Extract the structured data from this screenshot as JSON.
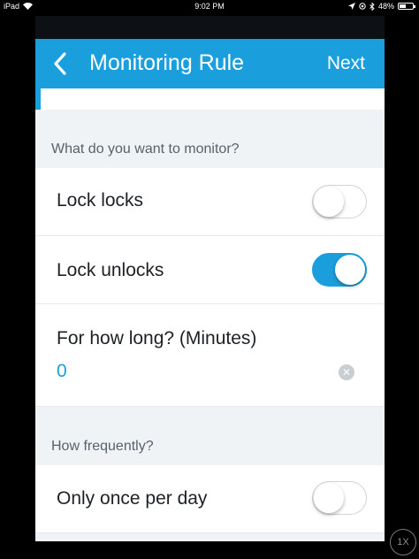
{
  "status_bar": {
    "device": "iPad",
    "time": "9:02 PM",
    "battery": "48%",
    "battery_level": 0.48,
    "icons": [
      "wifi-icon",
      "location-icon",
      "orientation-lock-icon",
      "bluetooth-icon",
      "battery-icon"
    ]
  },
  "nav": {
    "back_icon": "chevron-left-icon",
    "title": "Monitoring Rule",
    "next_label": "Next"
  },
  "sections": [
    {
      "header": "What do you want to monitor?",
      "rows": [
        {
          "label": "Lock locks",
          "toggle": false
        },
        {
          "label": "Lock unlocks",
          "toggle": true
        }
      ],
      "duration": {
        "label": "For how long? (Minutes)",
        "value": "0",
        "clear_icon": "clear-x-icon"
      }
    },
    {
      "header": "How frequently?",
      "rows": [
        {
          "label": "Only once per day",
          "toggle": false
        }
      ]
    }
  ],
  "zoom_label": "1X",
  "colors": {
    "accent": "#1a9fdc",
    "background": "#eff3f6",
    "cell": "#ffffff",
    "text": "#1d2125",
    "muted_text": "#59616a"
  }
}
